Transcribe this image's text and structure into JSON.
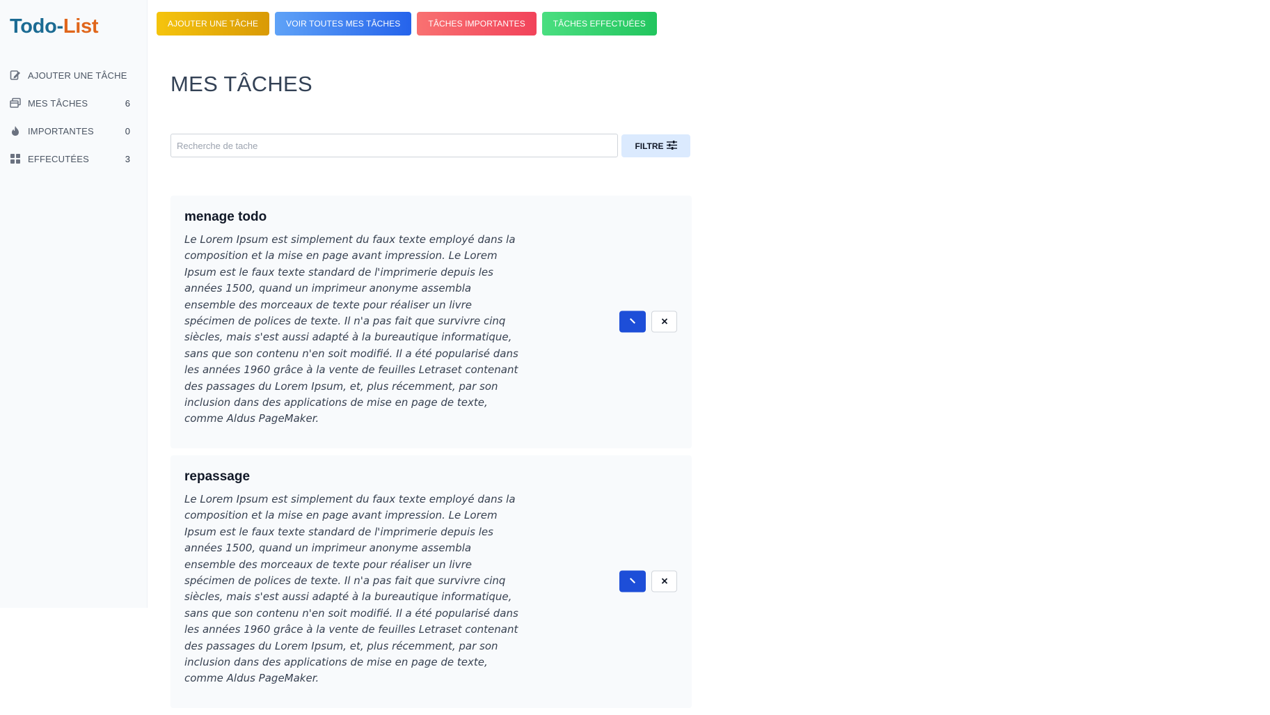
{
  "app": {
    "logo_part1": "Todo",
    "logo_sep": "-",
    "logo_part2": "List"
  },
  "sidebar": {
    "items": [
      {
        "label": "AJOUTER UNE TÂCHE",
        "icon": "edit-note-icon",
        "count": ""
      },
      {
        "label": "MES TÂCHES",
        "icon": "windows-icon",
        "count": "6"
      },
      {
        "label": "IMPORTANTES",
        "icon": "flame-icon",
        "count": "0"
      },
      {
        "label": "EFFECUTÉES",
        "icon": "grid-icon",
        "count": "3"
      }
    ]
  },
  "topbar": {
    "add_label": "AJOUTER UNE TÂCHE",
    "all_label": "VOIR TOUTES MES TÂCHES",
    "important_label": "TÂCHES IMPORTANTES",
    "done_label": "TÂCHES EFFECTUÉES"
  },
  "main": {
    "title": "MES TÂCHES",
    "search_placeholder": "Recherche de tache",
    "filter_label": "FILTRE"
  },
  "tasks": [
    {
      "title": "menage todo",
      "description": "Le Lorem Ipsum est simplement du faux texte employé dans la composition et la mise en page avant impression. Le Lorem Ipsum est le faux texte standard de l'imprimerie depuis les années 1500, quand un imprimeur anonyme assembla ensemble des morceaux de texte pour réaliser un livre spécimen de polices de texte. Il n'a pas fait que survivre cinq siècles, mais s'est aussi adapté à la bureautique informatique, sans que son contenu n'en soit modifié. Il a été popularisé dans les années 1960 grâce à la vente de feuilles Letraset contenant des passages du Lorem Ipsum, et, plus récemment, par son inclusion dans des applications de mise en page de texte, comme Aldus PageMaker."
    },
    {
      "title": "repassage",
      "description": "Le Lorem Ipsum est simplement du faux texte employé dans la composition et la mise en page avant impression. Le Lorem Ipsum est le faux texte standard de l'imprimerie depuis les années 1500, quand un imprimeur anonyme assembla ensemble des morceaux de texte pour réaliser un livre spécimen de polices de texte. Il n'a pas fait que survivre cinq siècles, mais s'est aussi adapté à la bureautique informatique, sans que son contenu n'en soit modifié. Il a été popularisé dans les années 1960 grâce à la vente de feuilles Letraset contenant des passages du Lorem Ipsum, et, plus récemment, par son inclusion dans des applications de mise en page de texte, comme Aldus PageMaker."
    }
  ],
  "colors": {
    "logo_blue": "#1b6b93",
    "logo_orange": "#e0661b",
    "primary": "#1d4ed8"
  }
}
